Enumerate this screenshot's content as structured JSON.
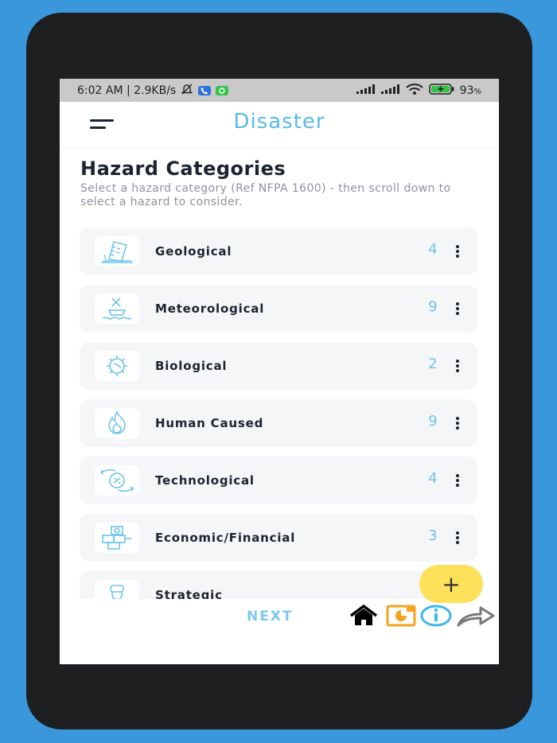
{
  "statusbar": {
    "time_speed": "6:02 AM | 2.9KB/s",
    "battery": "93",
    "battery_unit": "%"
  },
  "appbar": {
    "title": "Disaster"
  },
  "page": {
    "heading": "Hazard Categories",
    "subheading": "Select a hazard category (Ref NFPA 1600) - then scroll down to select a hazard to consider."
  },
  "categories": [
    {
      "label": "Geological",
      "count": "4",
      "icon": "building-collapse-icon"
    },
    {
      "label": "Meteorological",
      "count": "9",
      "icon": "flood-icon"
    },
    {
      "label": "Biological",
      "count": "2",
      "icon": "virus-icon"
    },
    {
      "label": "Human Caused",
      "count": "9",
      "icon": "fire-icon"
    },
    {
      "label": "Technological",
      "count": "4",
      "icon": "cycle-arrows-icon"
    },
    {
      "label": "Economic/Financial",
      "count": "3",
      "icon": "currency-blocks-icon"
    },
    {
      "label": "Strategic",
      "count": "",
      "icon": "person-icon"
    }
  ],
  "fab": {
    "label": "+"
  },
  "bottom": {
    "next_label": "NEXT",
    "icons": [
      "home-icon",
      "report-icon",
      "info-icon",
      "share-icon"
    ]
  },
  "colors": {
    "accent": "#5bbbe6",
    "fab": "#fde15a",
    "background": "#3b97dc"
  }
}
